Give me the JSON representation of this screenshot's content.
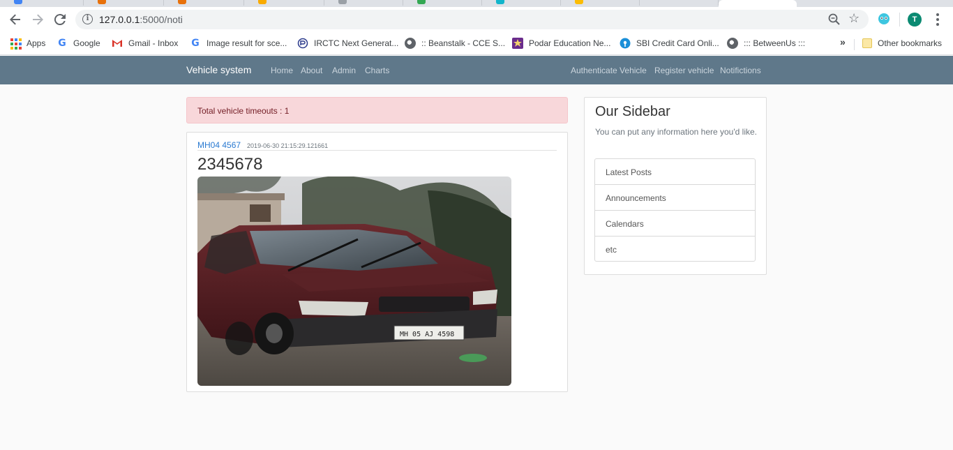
{
  "browser": {
    "url_host": "127.0.0.1",
    "url_path": ":5000/noti",
    "avatar_letter": "T",
    "bookmarks": [
      {
        "label": "Apps",
        "icon": "apps-grid-icon"
      },
      {
        "label": "Google",
        "icon": "google-icon"
      },
      {
        "label": "Gmail - Inbox",
        "icon": "gmail-icon"
      },
      {
        "label": "Image result for sce...",
        "icon": "google-icon"
      },
      {
        "label": "IRCTC Next Generat...",
        "icon": "irctc-icon"
      },
      {
        "label": ":: Beanstalk - CCE S...",
        "icon": "globe-icon"
      },
      {
        "label": "Podar Education Ne...",
        "icon": "podar-icon"
      },
      {
        "label": "SBI Credit Card Onli...",
        "icon": "sbi-icon"
      },
      {
        "label": "::: BetweenUs :::",
        "icon": "globe-icon"
      }
    ],
    "overflow_label": "»",
    "other_bookmarks": "Other bookmarks"
  },
  "navbar": {
    "brand": "Vehicle system",
    "left_links": [
      "Home",
      "About",
      "Admin",
      "Charts"
    ],
    "right_links": [
      "Authenticate Vehicle",
      "Register vehicle",
      "Notifictions"
    ]
  },
  "alert": {
    "text": "Total vehicle timeouts : 1"
  },
  "post": {
    "plate": "MH04 4567",
    "timestamp": "2019-06-30 21:15:29.121661",
    "number": "2345678"
  },
  "sidebar": {
    "title": "Our Sidebar",
    "description": "You can put any information here you'd like.",
    "items": [
      "Latest Posts",
      "Announcements",
      "Calendars",
      "etc"
    ]
  },
  "colors": {
    "navbar_bg": "#5f788a",
    "alert_bg": "#f8d7da",
    "link": "#2a7ad1"
  }
}
